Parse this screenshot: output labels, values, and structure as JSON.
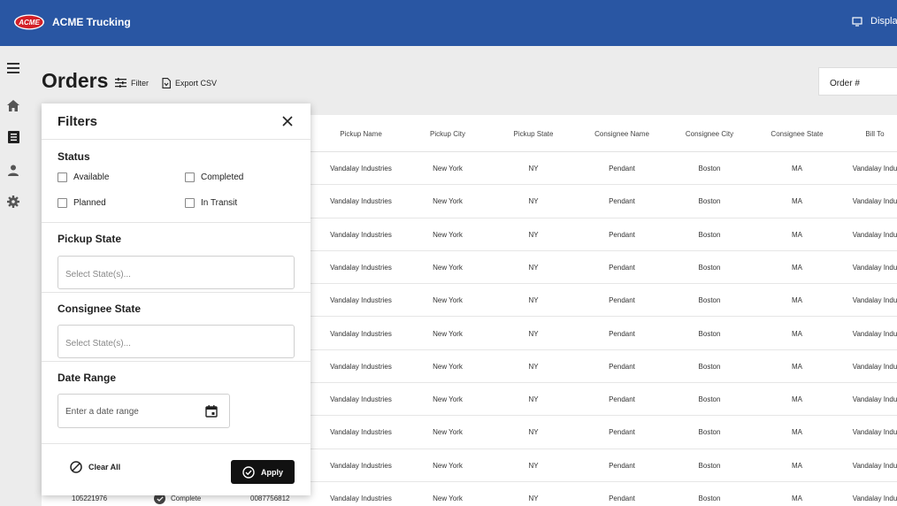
{
  "header": {
    "logo_text": "ACME",
    "app_title": "ACME Trucking",
    "display_label": "Display"
  },
  "rail": [
    "menu-icon",
    "home-icon",
    "orders-icon",
    "user-icon",
    "gear-icon"
  ],
  "page": {
    "title": "Orders",
    "filter_label": "Filter",
    "export_label": "Export CSV",
    "order_search_placeholder": "Order #"
  },
  "table": {
    "columns": [
      "Pickup Name",
      "Pickup City",
      "Pickup State",
      "Consignee Name",
      "Consignee City",
      "Consignee State",
      "Bill To"
    ],
    "rows": [
      [
        "Vandalay Industries",
        "New York",
        "NY",
        "Pendant",
        "Boston",
        "MA",
        "Vandalay Indu"
      ],
      [
        "Vandalay Industries",
        "New York",
        "NY",
        "Pendant",
        "Boston",
        "MA",
        "Vandalay Indu"
      ],
      [
        "Vandalay Industries",
        "New York",
        "NY",
        "Pendant",
        "Boston",
        "MA",
        "Vandalay Indu"
      ],
      [
        "Vandalay Industries",
        "New York",
        "NY",
        "Pendant",
        "Boston",
        "MA",
        "Vandalay Indu"
      ],
      [
        "Vandalay Industries",
        "New York",
        "NY",
        "Pendant",
        "Boston",
        "MA",
        "Vandalay Indu"
      ],
      [
        "Vandalay Industries",
        "New York",
        "NY",
        "Pendant",
        "Boston",
        "MA",
        "Vandalay Indu"
      ],
      [
        "Vandalay Industries",
        "New York",
        "NY",
        "Pendant",
        "Boston",
        "MA",
        "Vandalay Indu"
      ],
      [
        "Vandalay Industries",
        "New York",
        "NY",
        "Pendant",
        "Boston",
        "MA",
        "Vandalay Indu"
      ],
      [
        "Vandalay Industries",
        "New York",
        "NY",
        "Pendant",
        "Boston",
        "MA",
        "Vandalay Indu"
      ],
      [
        "Vandalay Industries",
        "New York",
        "NY",
        "Pendant",
        "Boston",
        "MA",
        "Vandalay Indu"
      ],
      [
        "Vandalay Industries",
        "New York",
        "NY",
        "Pendant",
        "Boston",
        "MA",
        "Vandalay Indu"
      ]
    ],
    "last_row_partial": {
      "order_no": "105221976",
      "status": "Complete",
      "ref": "0087756812"
    }
  },
  "filters": {
    "title": "Filters",
    "status_label": "Status",
    "status_options": [
      "Available",
      "Completed",
      "Planned",
      "In Transit"
    ],
    "pickup_state_label": "Pickup State",
    "pickup_state_placeholder": "Select State(s)...",
    "consignee_state_label": "Consignee State",
    "consignee_state_placeholder": "Select State(s)...",
    "date_range_label": "Date Range",
    "date_range_placeholder": "Enter a date range",
    "clear_label": "Clear All",
    "apply_label": "Apply"
  },
  "colors": {
    "header_bg": "#2956a3",
    "apply_bg": "#111111",
    "logo_red": "#d32027"
  }
}
